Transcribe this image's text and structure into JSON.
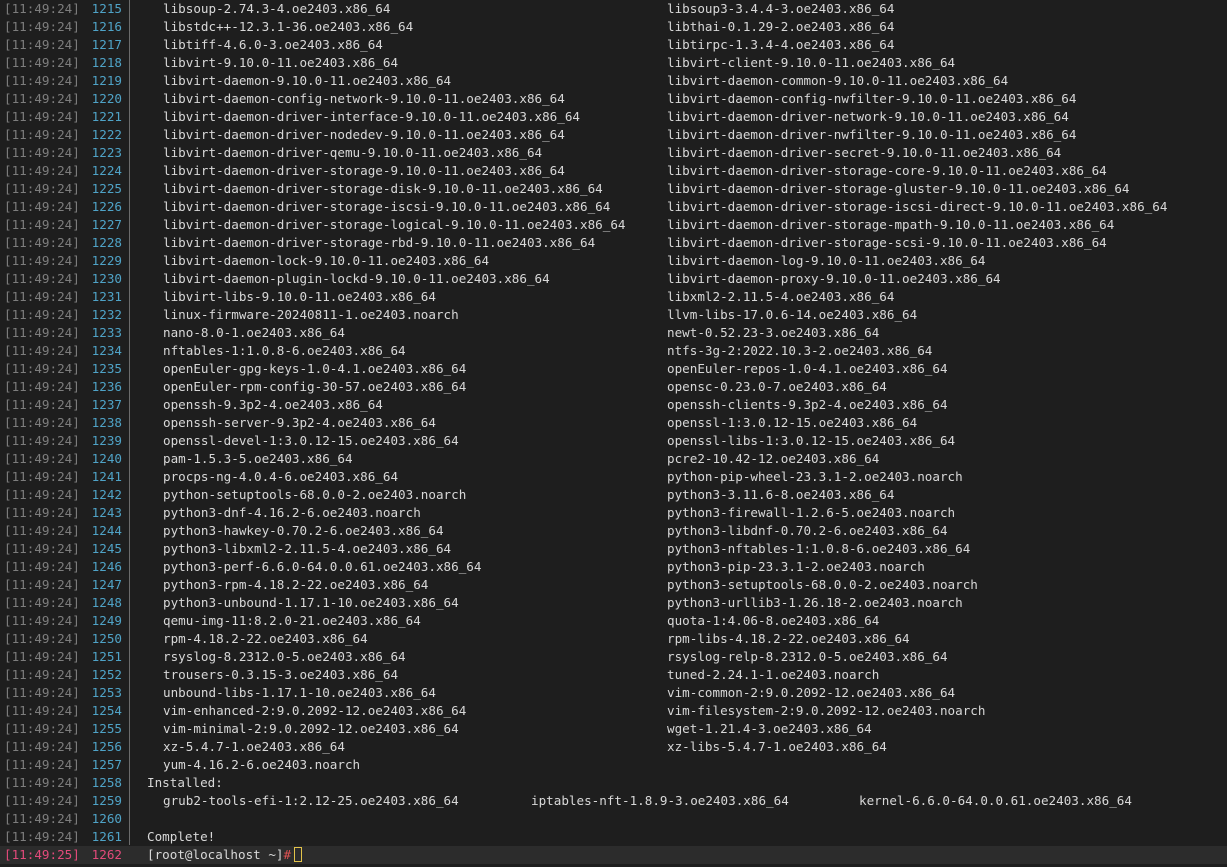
{
  "colors": {
    "background": "#1e1e1e",
    "text": "#d8d8d8",
    "timestamp": "#7d7d7d",
    "line_number": "#4fa3c7",
    "highlight": "#e24a7a",
    "epoch": "#c9c97a",
    "prompt_hash": "#e05252",
    "cursor": "#e3c34a"
  },
  "package_rows": [
    {
      "ts": "[11:49:24]",
      "ln": "1215",
      "a": "libsoup-2.74.3-4.oe2403.x86_64",
      "b": "libsoup3-3.4.4-3.oe2403.x86_64"
    },
    {
      "ts": "[11:49:24]",
      "ln": "1216",
      "a": "libstdc++-12.3.1-36.oe2403.x86_64",
      "b": "libthai-0.1.29-2.oe2403.x86_64"
    },
    {
      "ts": "[11:49:24]",
      "ln": "1217",
      "a": "libtiff-4.6.0-3.oe2403.x86_64",
      "b": "libtirpc-1.3.4-4.oe2403.x86_64"
    },
    {
      "ts": "[11:49:24]",
      "ln": "1218",
      "a": "libvirt-9.10.0-11.oe2403.x86_64",
      "b": "libvirt-client-9.10.0-11.oe2403.x86_64"
    },
    {
      "ts": "[11:49:24]",
      "ln": "1219",
      "a": "libvirt-daemon-9.10.0-11.oe2403.x86_64",
      "b": "libvirt-daemon-common-9.10.0-11.oe2403.x86_64"
    },
    {
      "ts": "[11:49:24]",
      "ln": "1220",
      "a": "libvirt-daemon-config-network-9.10.0-11.oe2403.x86_64",
      "b": "libvirt-daemon-config-nwfilter-9.10.0-11.oe2403.x86_64"
    },
    {
      "ts": "[11:49:24]",
      "ln": "1221",
      "a": "libvirt-daemon-driver-interface-9.10.0-11.oe2403.x86_64",
      "b": "libvirt-daemon-driver-network-9.10.0-11.oe2403.x86_64"
    },
    {
      "ts": "[11:49:24]",
      "ln": "1222",
      "a": "libvirt-daemon-driver-nodedev-9.10.0-11.oe2403.x86_64",
      "b": "libvirt-daemon-driver-nwfilter-9.10.0-11.oe2403.x86_64"
    },
    {
      "ts": "[11:49:24]",
      "ln": "1223",
      "a": "libvirt-daemon-driver-qemu-9.10.0-11.oe2403.x86_64",
      "b": "libvirt-daemon-driver-secret-9.10.0-11.oe2403.x86_64"
    },
    {
      "ts": "[11:49:24]",
      "ln": "1224",
      "a": "libvirt-daemon-driver-storage-9.10.0-11.oe2403.x86_64",
      "b": "libvirt-daemon-driver-storage-core-9.10.0-11.oe2403.x86_64"
    },
    {
      "ts": "[11:49:24]",
      "ln": "1225",
      "a": "libvirt-daemon-driver-storage-disk-9.10.0-11.oe2403.x86_64",
      "b": "libvirt-daemon-driver-storage-gluster-9.10.0-11.oe2403.x86_64"
    },
    {
      "ts": "[11:49:24]",
      "ln": "1226",
      "a": "libvirt-daemon-driver-storage-iscsi-9.10.0-11.oe2403.x86_64",
      "b": "libvirt-daemon-driver-storage-iscsi-direct-9.10.0-11.oe2403.x86_64"
    },
    {
      "ts": "[11:49:24]",
      "ln": "1227",
      "a": "libvirt-daemon-driver-storage-logical-9.10.0-11.oe2403.x86_64",
      "b": "libvirt-daemon-driver-storage-mpath-9.10.0-11.oe2403.x86_64"
    },
    {
      "ts": "[11:49:24]",
      "ln": "1228",
      "a": "libvirt-daemon-driver-storage-rbd-9.10.0-11.oe2403.x86_64",
      "b": "libvirt-daemon-driver-storage-scsi-9.10.0-11.oe2403.x86_64"
    },
    {
      "ts": "[11:49:24]",
      "ln": "1229",
      "a": "libvirt-daemon-lock-9.10.0-11.oe2403.x86_64",
      "b": "libvirt-daemon-log-9.10.0-11.oe2403.x86_64"
    },
    {
      "ts": "[11:49:24]",
      "ln": "1230",
      "a": "libvirt-daemon-plugin-lockd-9.10.0-11.oe2403.x86_64",
      "b": "libvirt-daemon-proxy-9.10.0-11.oe2403.x86_64"
    },
    {
      "ts": "[11:49:24]",
      "ln": "1231",
      "a": "libvirt-libs-9.10.0-11.oe2403.x86_64",
      "b": "libxml2-2.11.5-4.oe2403.x86_64"
    },
    {
      "ts": "[11:49:24]",
      "ln": "1232",
      "a": "linux-firmware-20240811-1.oe2403.noarch",
      "b": "llvm-libs-17.0.6-14.oe2403.x86_64"
    },
    {
      "ts": "[11:49:24]",
      "ln": "1233",
      "a": "nano-8.0-1.oe2403.x86_64",
      "b": "newt-0.52.23-3.oe2403.x86_64"
    },
    {
      "ts": "[11:49:24]",
      "ln": "1234",
      "a": "nftables-1:1.0.8-6.oe2403.x86_64",
      "b": "ntfs-3g-2:2022.10.3-2.oe2403.x86_64"
    },
    {
      "ts": "[11:49:24]",
      "ln": "1235",
      "a": "openEuler-gpg-keys-1.0-4.1.oe2403.x86_64",
      "b": "openEuler-repos-1.0-4.1.oe2403.x86_64"
    },
    {
      "ts": "[11:49:24]",
      "ln": "1236",
      "a": "openEuler-rpm-config-30-57.oe2403.x86_64",
      "b": "opensc-0.23.0-7.oe2403.x86_64"
    },
    {
      "ts": "[11:49:24]",
      "ln": "1237",
      "a": "openssh-9.3p2-4.oe2403.x86_64",
      "b": "openssh-clients-9.3p2-4.oe2403.x86_64"
    },
    {
      "ts": "[11:49:24]",
      "ln": "1238",
      "a": "openssh-server-9.3p2-4.oe2403.x86_64",
      "b": "openssl-1:3.0.12-15.oe2403.x86_64"
    },
    {
      "ts": "[11:49:24]",
      "ln": "1239",
      "a": "openssl-devel-1:3.0.12-15.oe2403.x86_64",
      "b": "openssl-libs-1:3.0.12-15.oe2403.x86_64"
    },
    {
      "ts": "[11:49:24]",
      "ln": "1240",
      "a": "pam-1.5.3-5.oe2403.x86_64",
      "b": "pcre2-10.42-12.oe2403.x86_64"
    },
    {
      "ts": "[11:49:24]",
      "ln": "1241",
      "a": "procps-ng-4.0.4-6.oe2403.x86_64",
      "b": "python-pip-wheel-23.3.1-2.oe2403.noarch"
    },
    {
      "ts": "[11:49:24]",
      "ln": "1242",
      "a": "python-setuptools-68.0.0-2.oe2403.noarch",
      "b": "python3-3.11.6-8.oe2403.x86_64"
    },
    {
      "ts": "[11:49:24]",
      "ln": "1243",
      "a": "python3-dnf-4.16.2-6.oe2403.noarch",
      "b": "python3-firewall-1.2.6-5.oe2403.noarch"
    },
    {
      "ts": "[11:49:24]",
      "ln": "1244",
      "a": "python3-hawkey-0.70.2-6.oe2403.x86_64",
      "b": "python3-libdnf-0.70.2-6.oe2403.x86_64"
    },
    {
      "ts": "[11:49:24]",
      "ln": "1245",
      "a": "python3-libxml2-2.11.5-4.oe2403.x86_64",
      "b": "python3-nftables-1:1.0.8-6.oe2403.x86_64"
    },
    {
      "ts": "[11:49:24]",
      "ln": "1246",
      "a": "python3-perf-6.6.0-64.0.0.61.oe2403.x86_64",
      "b": "python3-pip-23.3.1-2.oe2403.noarch"
    },
    {
      "ts": "[11:49:24]",
      "ln": "1247",
      "a": "python3-rpm-4.18.2-22.oe2403.x86_64",
      "b": "python3-setuptools-68.0.0-2.oe2403.noarch"
    },
    {
      "ts": "[11:49:24]",
      "ln": "1248",
      "a": "python3-unbound-1.17.1-10.oe2403.x86_64",
      "b": "python3-urllib3-1.26.18-2.oe2403.noarch"
    },
    {
      "ts": "[11:49:24]",
      "ln": "1249",
      "a": "qemu-img-11:8.2.0-21.oe2403.x86_64",
      "b": "quota-1:4.06-8.oe2403.x86_64"
    },
    {
      "ts": "[11:49:24]",
      "ln": "1250",
      "a": "rpm-4.18.2-22.oe2403.x86_64",
      "b": "rpm-libs-4.18.2-22.oe2403.x86_64"
    },
    {
      "ts": "[11:49:24]",
      "ln": "1251",
      "a": "rsyslog-8.2312.0-5.oe2403.x86_64",
      "b": "rsyslog-relp-8.2312.0-5.oe2403.x86_64"
    },
    {
      "ts": "[11:49:24]",
      "ln": "1252",
      "a": "trousers-0.3.15-3.oe2403.x86_64",
      "b": "tuned-2.24.1-1.oe2403.noarch"
    },
    {
      "ts": "[11:49:24]",
      "ln": "1253",
      "a": "unbound-libs-1.17.1-10.oe2403.x86_64",
      "b": "vim-common-2:9.0.2092-12.oe2403.x86_64"
    },
    {
      "ts": "[11:49:24]",
      "ln": "1254",
      "a": "vim-enhanced-2:9.0.2092-12.oe2403.x86_64",
      "b": "vim-filesystem-2:9.0.2092-12.oe2403.noarch"
    },
    {
      "ts": "[11:49:24]",
      "ln": "1255",
      "a": "vim-minimal-2:9.0.2092-12.oe2403.x86_64",
      "b": "wget-1.21.4-3.oe2403.x86_64"
    },
    {
      "ts": "[11:49:24]",
      "ln": "1256",
      "a": "xz-5.4.7-1.oe2403.x86_64",
      "b": "xz-libs-5.4.7-1.oe2403.x86_64"
    },
    {
      "ts": "[11:49:24]",
      "ln": "1257",
      "a": "yum-4.16.2-6.oe2403.noarch",
      "b": ""
    }
  ],
  "installed_header": {
    "ts": "[11:49:24]",
    "ln": "1258",
    "text": "Installed:"
  },
  "installed_row": {
    "ts": "[11:49:24]",
    "ln": "1259",
    "a": "grub2-tools-efi-1:2.12-25.oe2403.x86_64",
    "b": "iptables-nft-1.8.9-3.oe2403.x86_64",
    "c": "kernel-6.6.0-64.0.0.61.oe2403.x86_64"
  },
  "blank_row": {
    "ts": "[11:49:24]",
    "ln": "1260"
  },
  "complete_row": {
    "ts": "[11:49:24]",
    "ln": "1261",
    "text": "Complete!"
  },
  "prompt_row": {
    "ts": "[11:49:25]",
    "ln": "1262",
    "prompt": "[root@localhost ~]",
    "hash": "#"
  }
}
